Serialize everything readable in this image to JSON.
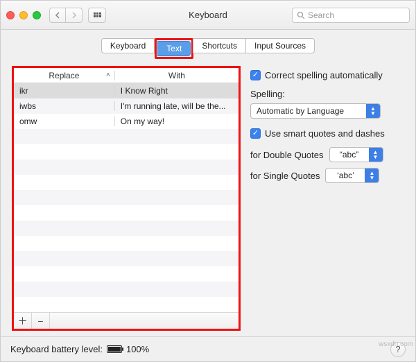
{
  "window": {
    "title": "Keyboard",
    "search_placeholder": "Search"
  },
  "tabs": {
    "items": [
      "Keyboard",
      "Text",
      "Shortcuts",
      "Input Sources"
    ],
    "active_index": 1
  },
  "table": {
    "head_replace": "Replace",
    "head_with": "With",
    "rows": [
      {
        "replace": "ikr",
        "with": "I Know Right",
        "selected": true
      },
      {
        "replace": "iwbs",
        "with": "I'm running late, will be the...",
        "selected": false
      },
      {
        "replace": "omw",
        "with": "On my way!",
        "selected": false
      }
    ]
  },
  "options": {
    "correct_spelling_label": "Correct spelling automatically",
    "spelling_heading": "Spelling:",
    "spelling_value": "Automatic by Language",
    "smart_quotes_label": "Use smart quotes and dashes",
    "double_quotes_label": "for Double Quotes",
    "double_quotes_value": "“abc”",
    "single_quotes_label": "for Single Quotes",
    "single_quotes_value": "‘abc’"
  },
  "status": {
    "battery_label": "Keyboard battery level:",
    "battery_pct": "100%"
  },
  "watermark": "wsxdn.com"
}
